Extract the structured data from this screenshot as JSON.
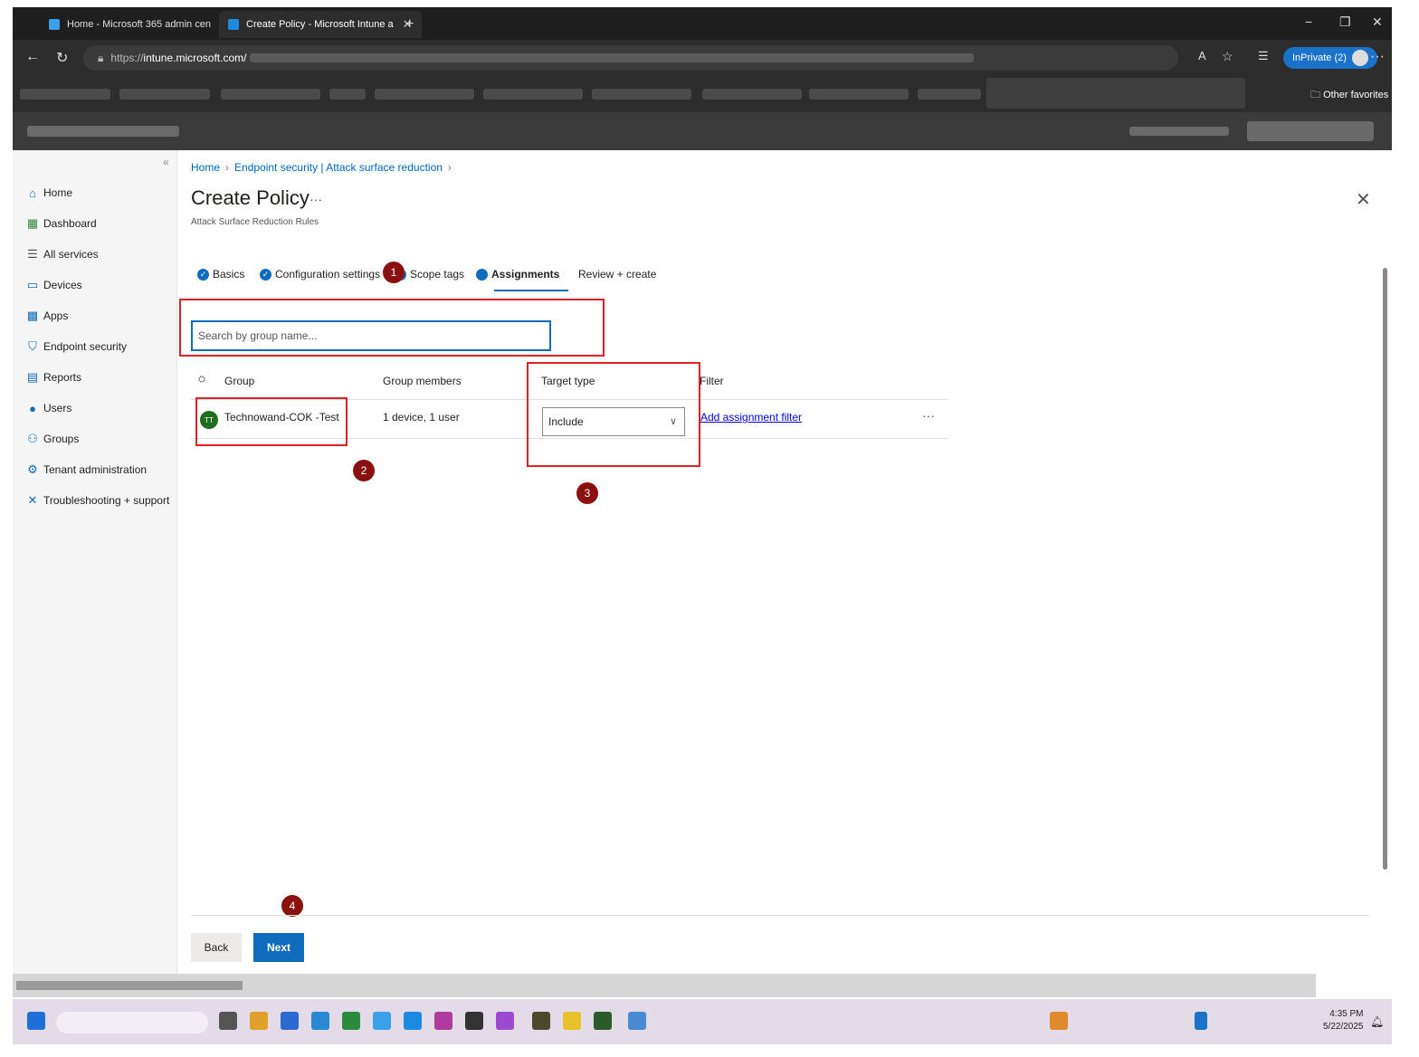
{
  "browser": {
    "tabs": [
      {
        "label": "Home - Microsoft 365 admin cen"
      },
      {
        "label": "Create Policy - Microsoft Intune a"
      }
    ],
    "url_prefix": "https://",
    "url_host": "intune.microsoft.com/",
    "inprivate_label": "InPrivate (2)",
    "other_favorites": "Other favorites"
  },
  "sidebar": {
    "items": [
      {
        "label": "Home",
        "icon": "home-icon"
      },
      {
        "label": "Dashboard",
        "icon": "dashboard-icon"
      },
      {
        "label": "All services",
        "icon": "list-icon"
      },
      {
        "label": "Devices",
        "icon": "devices-icon"
      },
      {
        "label": "Apps",
        "icon": "apps-icon"
      },
      {
        "label": "Endpoint security",
        "icon": "shield-icon"
      },
      {
        "label": "Reports",
        "icon": "reports-icon"
      },
      {
        "label": "Users",
        "icon": "user-icon"
      },
      {
        "label": "Groups",
        "icon": "groups-icon"
      },
      {
        "label": "Tenant administration",
        "icon": "tenant-icon"
      },
      {
        "label": "Troubleshooting + support",
        "icon": "wrench-icon"
      }
    ]
  },
  "breadcrumb": [
    "Home",
    "Endpoint security | Attack surface reduction"
  ],
  "page": {
    "title": "Create Policy",
    "subtitle": "Attack Surface Reduction Rules"
  },
  "wizard_tabs": [
    {
      "label": "Basics",
      "state": "complete"
    },
    {
      "label": "Configuration settings",
      "state": "complete"
    },
    {
      "label": "Scope tags",
      "state": "complete"
    },
    {
      "label": "Assignments",
      "state": "active"
    },
    {
      "label": "Review + create",
      "state": "pending"
    }
  ],
  "search": {
    "placeholder": "Search by group name..."
  },
  "grid": {
    "headers": [
      "Group",
      "Group members",
      "Target type",
      "Filter"
    ],
    "rows": [
      {
        "initials": "TT",
        "group": "Technowand-COK -Test",
        "members": "1 device, 1 user",
        "target_type": "Include",
        "filter_link": "Add assignment filter"
      }
    ]
  },
  "markers": [
    "1",
    "2",
    "3",
    "4"
  ],
  "buttons": {
    "back": "Back",
    "next": "Next"
  },
  "clock": {
    "time": "4:35 PM",
    "date": "5/22/2025"
  },
  "colors": {
    "accent": "#0f6cbd",
    "annotation_red": "#e01f26",
    "marker_bg": "#8b1111"
  }
}
